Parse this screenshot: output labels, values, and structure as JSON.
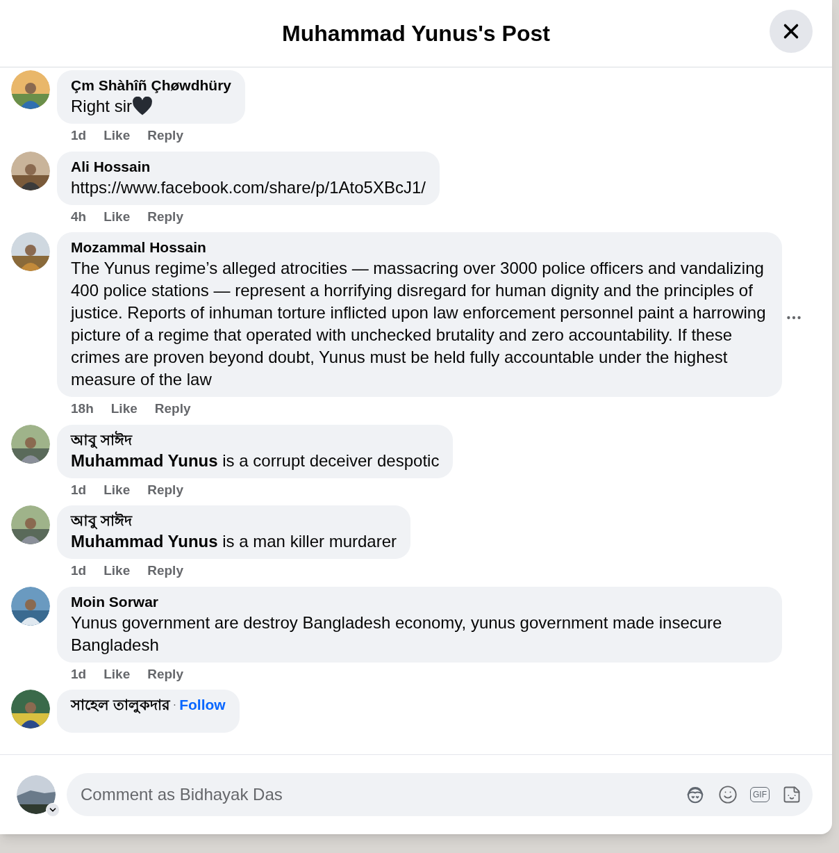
{
  "dialog": {
    "title": "Muhammad Yunus's Post"
  },
  "comments": [
    {
      "author": "Çm Shàhîñ Çhøwdhüry",
      "text": "Right sir",
      "heart": true,
      "time": "1d",
      "actions": [
        "Like",
        "Reply"
      ],
      "menu_visible": false
    },
    {
      "author": "Ali Hossain",
      "text": "https://www.facebook.com/share/p/1Ato5XBcJ1/",
      "heart": false,
      "time": "4h",
      "actions": [
        "Like",
        "Reply"
      ],
      "menu_visible": false
    },
    {
      "author": "Mozammal Hossain",
      "text": "The Yunus regime’s alleged atrocities — massacring over 3000 police officers and vandalizing 400 police stations — represent a horrifying disregard for human dignity and the principles of justice. Reports of inhuman torture inflicted upon law enforcement personnel paint a harrowing picture of a regime that operated with unchecked brutality and zero accountability. If these crimes are proven beyond doubt, Yunus must be held fully accountable under the highest measure of the law",
      "heart": false,
      "time": "18h",
      "actions": [
        "Like",
        "Reply"
      ],
      "menu_visible": true
    },
    {
      "author": "আবু সাঈদ",
      "text": "**Muhammad Yunus** is a corrupt deceiver despotic",
      "heart": false,
      "time": "1d",
      "actions": [
        "Like",
        "Reply"
      ],
      "menu_visible": false
    },
    {
      "author": "আবু সাঈদ",
      "text": "**Muhammad Yunus** is a man killer murdarer",
      "heart": false,
      "time": "1d",
      "actions": [
        "Like",
        "Reply"
      ],
      "menu_visible": false
    },
    {
      "author": "Moin Sorwar",
      "text": "Yunus government are destroy Bangladesh economy, yunus government made insecure Bangladesh",
      "heart": false,
      "time": "1d",
      "actions": [
        "Like",
        "Reply"
      ],
      "menu_visible": false
    },
    {
      "author": "সাহেল তালুকদার",
      "follow": "Follow",
      "separator": "·"
    }
  ],
  "composer": {
    "placeholder": "Comment as Bidhayak Das",
    "gif_label": "GIF"
  }
}
